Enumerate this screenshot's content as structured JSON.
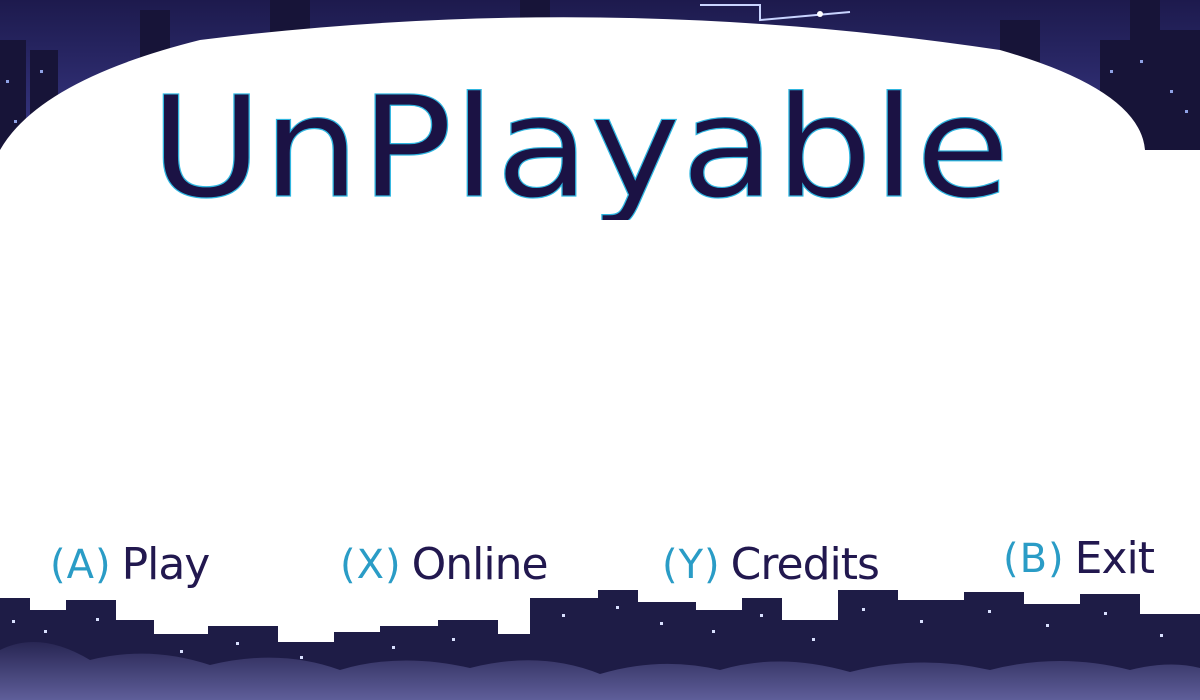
{
  "game": {
    "title": "UnPlayable"
  },
  "menu": [
    {
      "key": "(A)",
      "label": "Play"
    },
    {
      "key": "(X)",
      "label": "Online"
    },
    {
      "key": "(Y)",
      "label": "Credits"
    },
    {
      "key": "(B)",
      "label": "Exit"
    }
  ],
  "colors": {
    "title": "#1b1244",
    "title_circuit": "#2fb6e0",
    "key": "#2a9cc6",
    "label": "#22184f",
    "sky": "#23205a",
    "buildings": "#1e1c46",
    "window": "#8fa2e6"
  }
}
